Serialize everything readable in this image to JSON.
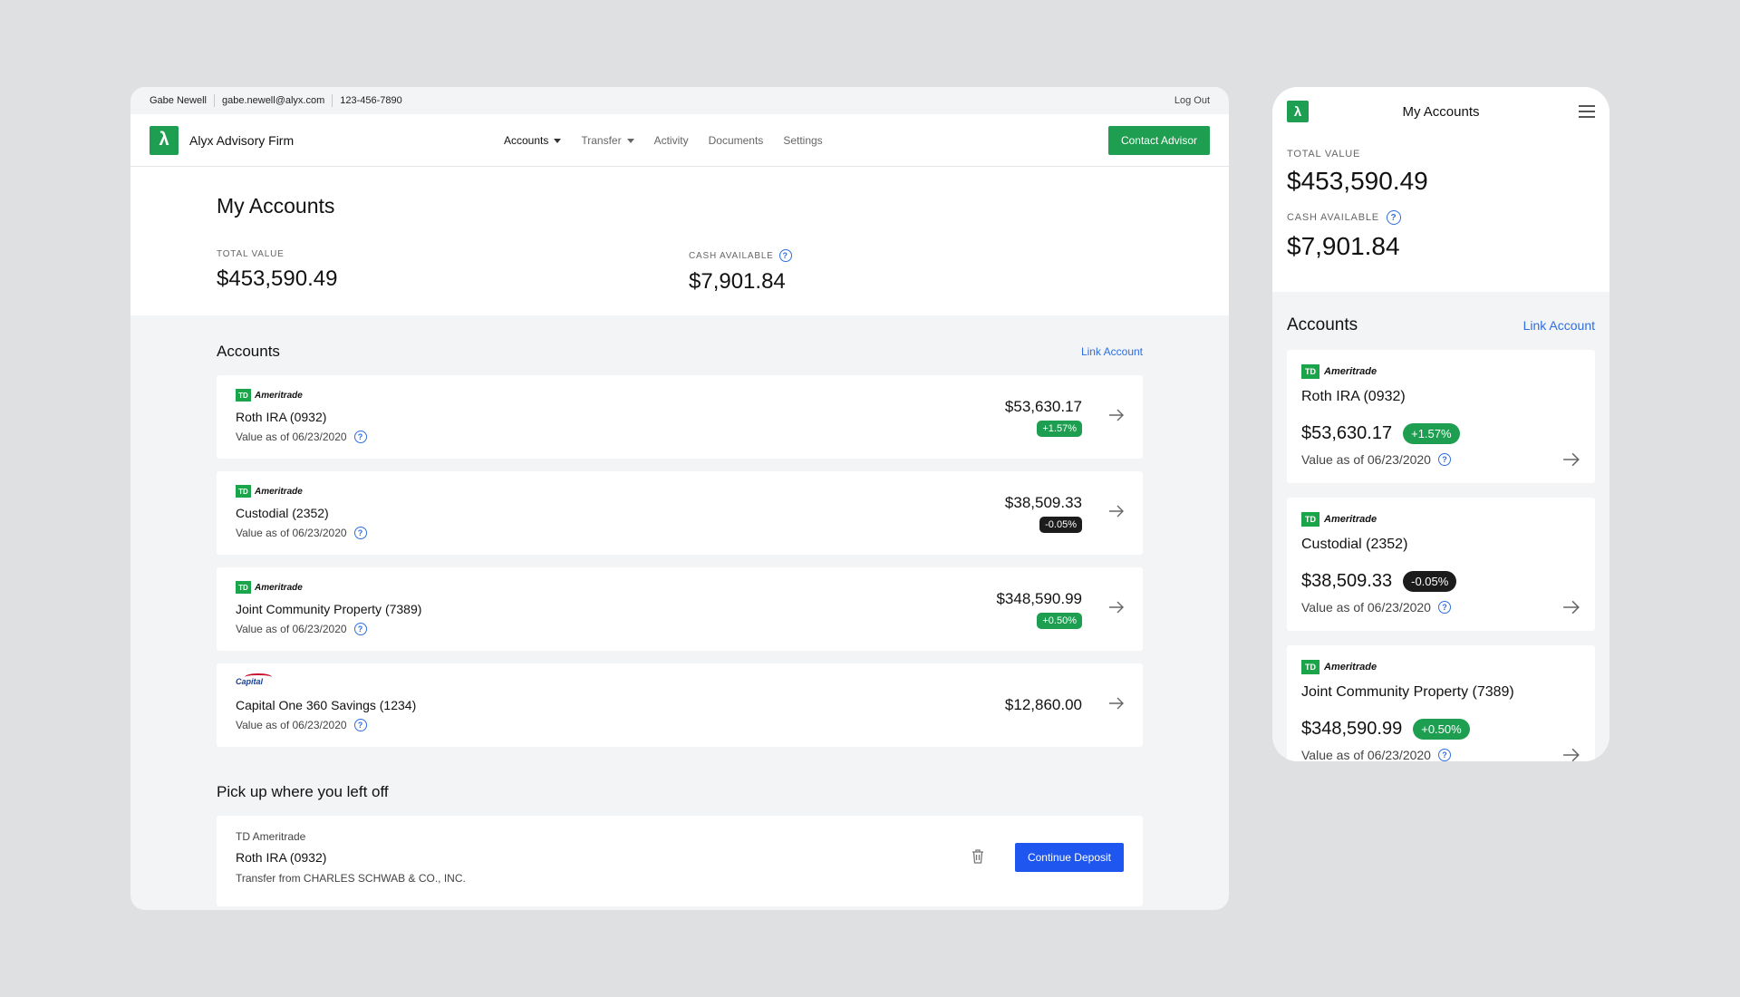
{
  "topbar": {
    "user_name": "Gabe Newell",
    "email": "gabe.newell@alyx.com",
    "phone": "123-456-7890",
    "logout": "Log Out"
  },
  "brand": {
    "logo_glyph": "λ",
    "name": "Alyx Advisory Firm"
  },
  "nav": {
    "accounts": "Accounts",
    "transfer": "Transfer",
    "activity": "Activity",
    "documents": "Documents",
    "settings": "Settings",
    "contact_advisor": "Contact Advisor"
  },
  "summary": {
    "title": "My Accounts",
    "total_value_label": "TOTAL VALUE",
    "total_value": "$453,590.49",
    "cash_label": "CASH AVAILABLE",
    "cash_value": "$7,901.84"
  },
  "accounts_section": {
    "title": "Accounts",
    "link_account": "Link Account"
  },
  "accounts": [
    {
      "bank": "Ameritrade",
      "bank_logo": "TD",
      "name": "Roth IRA (0932)",
      "as_of": "Value as of 06/23/2020",
      "amount": "$53,630.17",
      "change": "+1.57%",
      "change_type": "positive"
    },
    {
      "bank": "Ameritrade",
      "bank_logo": "TD",
      "name": "Custodial (2352)",
      "as_of": "Value as of 06/23/2020",
      "amount": "$38,509.33",
      "change": "-0.05%",
      "change_type": "negative"
    },
    {
      "bank": "Ameritrade",
      "bank_logo": "TD",
      "name": "Joint Community Property (7389)",
      "as_of": "Value as of 06/23/2020",
      "amount": "$348,590.99",
      "change": "+0.50%",
      "change_type": "positive"
    },
    {
      "bank": "Capital One",
      "bank_logo": "Capital",
      "name": "Capital One 360 Savings (1234)",
      "as_of": "Value as of 06/23/2020",
      "amount": "$12,860.00",
      "change": "",
      "change_type": "none"
    }
  ],
  "pickup": {
    "title": "Pick up where you left off",
    "institution": "TD Ameritrade",
    "account": "Roth IRA (0932)",
    "detail": "Transfer from CHARLES SCHWAB & CO., INC.",
    "button": "Continue Deposit"
  },
  "mobile": {
    "title": "My Accounts",
    "logo_glyph": "λ",
    "total_value_label": "TOTAL VALUE",
    "total_value": "$453,590.49",
    "cash_label": "CASH AVAILABLE",
    "cash_value": "$7,901.84",
    "section_title": "Accounts",
    "link_account": "Link Account"
  },
  "icons": {
    "help": "?",
    "td": "TD"
  },
  "colors": {
    "brand_green": "#1e9e50",
    "link_blue": "#2f6de0",
    "deposit_blue": "#1f56f0",
    "negative_badge": "#1c1c1c"
  }
}
